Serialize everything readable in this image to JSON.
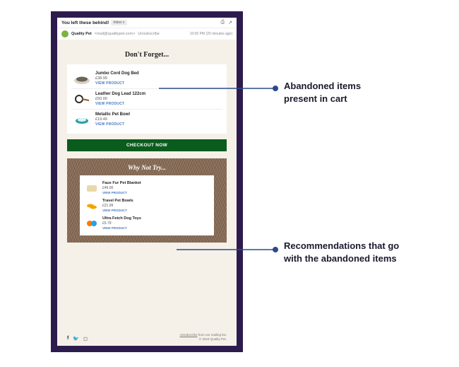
{
  "gmail": {
    "subject": "You left these behind!",
    "inbox_tag": "Inbox x",
    "sender_name": "Quality Pet",
    "sender_email": "<mail@qualitypet.com>",
    "unsub_inline": "Unsubscribe",
    "timestamp": "10:00 PM (20 minutes ago)"
  },
  "dont_forget": {
    "title": "Don't Forget...",
    "items": [
      {
        "name": "Jumbo Cord Dog Bed",
        "price": "£38.99",
        "link": "VIEW PRODUCT"
      },
      {
        "name": "Leather Dog Lead 122cm",
        "price": "£50.00",
        "link": "VIEW PRODUCT"
      },
      {
        "name": "Metallic Pet Bowl",
        "price": "£19.49",
        "link": "VIEW PRODUCT"
      }
    ]
  },
  "checkout_label": "CHECKOUT NOW",
  "why_not_try": {
    "title": "Why Not Try...",
    "items": [
      {
        "name": "Faux Fur Pet Blanket",
        "price": "£49.00",
        "link": "VIEW PRODUCT"
      },
      {
        "name": "Travel Pet Bowls",
        "price": "£21.99",
        "link": "VIEW PRODUCT"
      },
      {
        "name": "Ultra Fetch Dog Toys",
        "price": "£5.79",
        "link": "VIEW PRODUCT"
      }
    ]
  },
  "footer": {
    "unsubscribe": "Unsubscribe",
    "unsubscribe_suffix": " from our mailing list.",
    "copyright": "© 2019 Quality Pet."
  },
  "annotations": {
    "a1_line1": "Abandoned items",
    "a1_line2": "present in cart",
    "a2_line1": "Recommendations that go",
    "a2_line2": "with the abandoned items"
  }
}
